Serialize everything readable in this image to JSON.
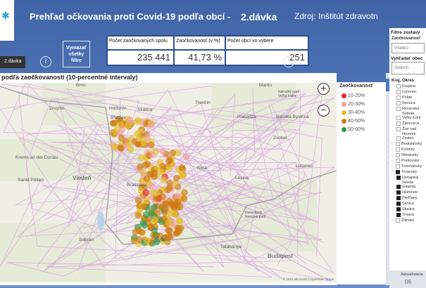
{
  "header": {
    "title": "Prehľad očkovania proti Covid-19 podľa obcí -",
    "dose": "2.dávka",
    "source": "Zdroj: Inštitút zdravotn"
  },
  "dose_button": "2.dávka",
  "clear_button": "Vymazať všetky filtre",
  "kpi": {
    "headers": [
      "Počet zaočkovaných spolu",
      "Zaočkovanosť (v %)",
      "Počet obcí vo výbere"
    ],
    "values": [
      "235 441",
      "41,73 %",
      "251"
    ]
  },
  "map": {
    "title": "podľa zaočkovanosti (10-percentné intervaly)",
    "copyright": "© 2021 Microsoft Corporation",
    "terms": "Terms",
    "labels": [
      "Brno",
      "Znojmo",
      "Hodonín",
      "Skalica",
      "Břeclav",
      "Krems an der Donau",
      "Sankt Pölten",
      "Viedeň",
      "Bratislava",
      "Győr",
      "Sopron",
      "Trenčín",
      "Nitra",
      "Prievidza",
      "Martin",
      "Banská Bystrica",
      "Zvolen",
      "Levice",
      "Lučenec",
      "Tatabánya",
      "Budapest",
      "Duna-Ipoly Nemzeti park",
      "Národný park Veľká Fatra"
    ]
  },
  "legend": {
    "title": "Zaočkovanosť",
    "items": [
      {
        "label": "10-20%",
        "color": "#e8262a"
      },
      {
        "label": "20-30%",
        "color": "#f0a0a0"
      },
      {
        "label": "30-40%",
        "color": "#e3c02c"
      },
      {
        "label": "40-50%",
        "color": "#d07a10"
      },
      {
        "label": "50-60%",
        "color": "#2a9a48"
      }
    ]
  },
  "filters": {
    "title": "Filtre zostavy",
    "dose_label": "Zaočkovanosť",
    "dose_value": "Všetko",
    "search_label": "Vyhľadať obec",
    "search_placeholder": "Search",
    "tree_header": "Kraj, Okres",
    "districts_top": [
      "Krupina",
      "Lučenec",
      "Poltár",
      "Revúca",
      "Rimavská Sobota",
      "Veľký Krtíš",
      "Žarnovica",
      "Žiar nad Hronom",
      "Zvolen"
    ],
    "regions": [
      "Bratislavský",
      "Košický",
      "Nitriansky",
      "Prešovský",
      "Trenčiansky"
    ],
    "trnava": "Trnavský",
    "trnava_districts": [
      "Dunajská Streda",
      "Galanta",
      "Hlohovec",
      "Piešťany",
      "Senica",
      "Skalica",
      "Trnava"
    ],
    "last": "Žilinský"
  },
  "bottom": {
    "label": "Aktualizácia",
    "value": "06"
  }
}
